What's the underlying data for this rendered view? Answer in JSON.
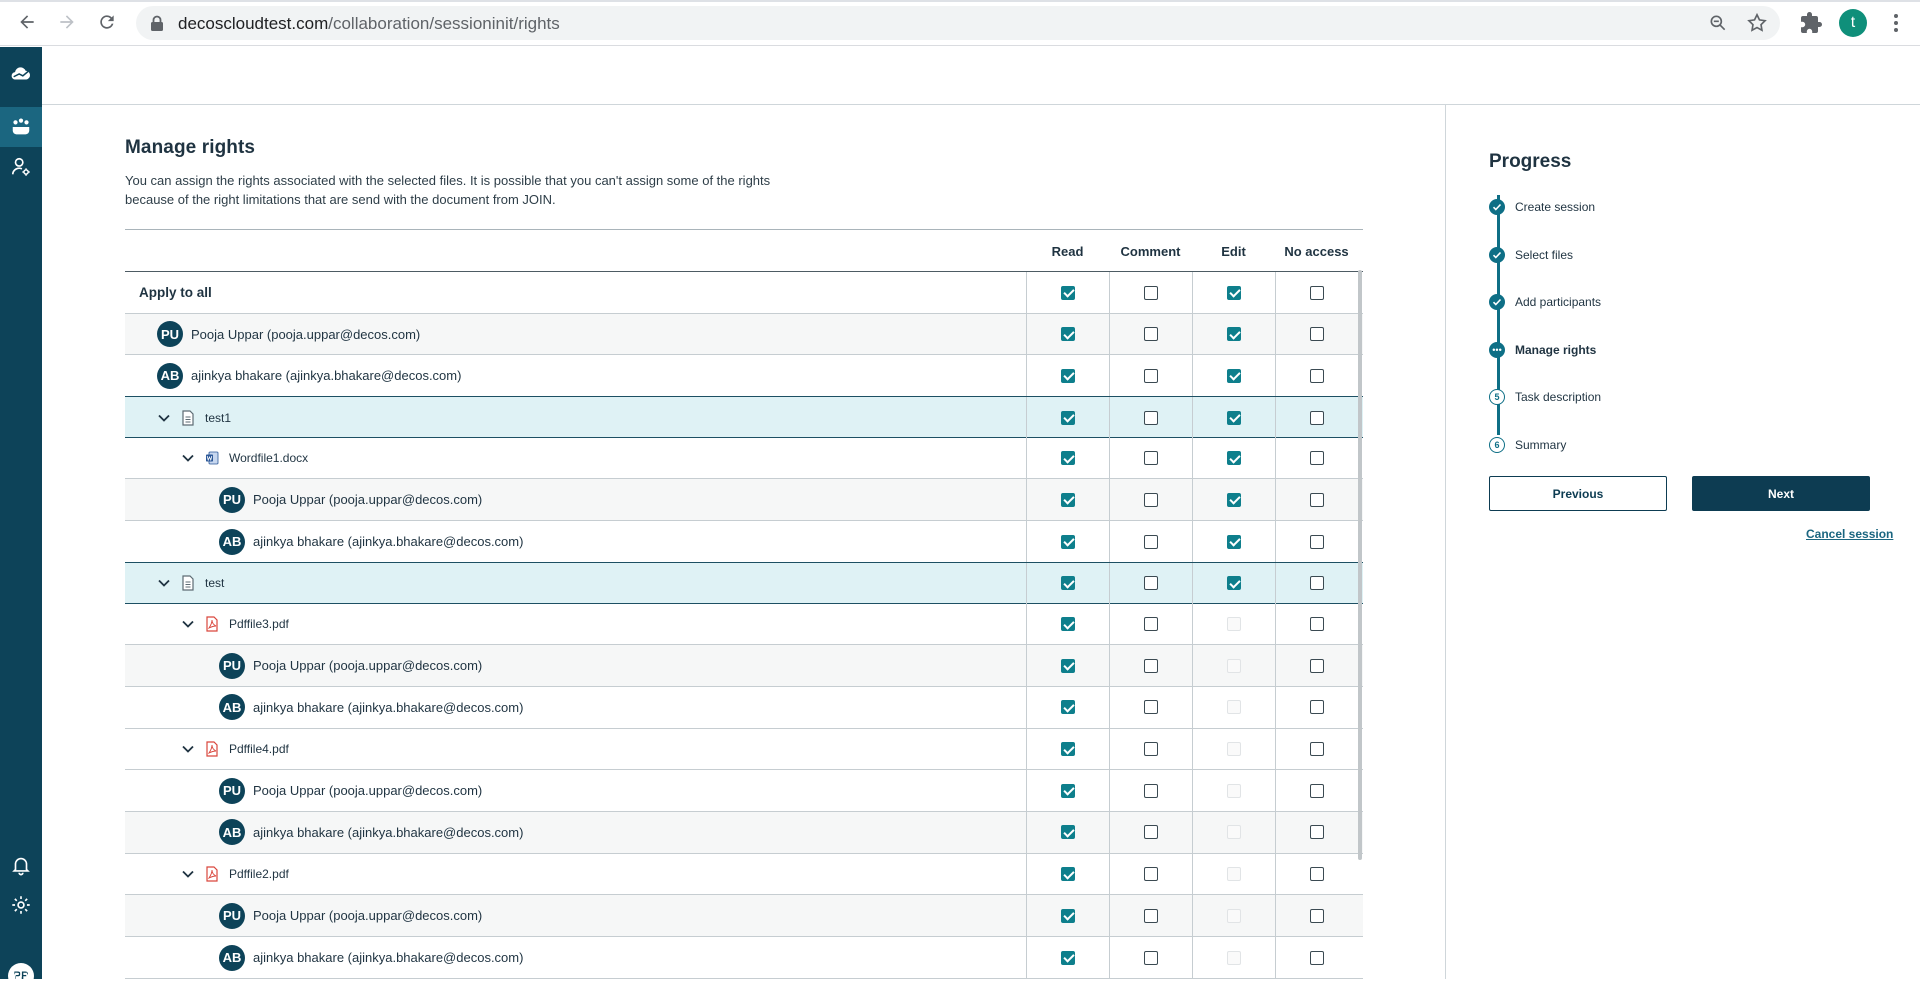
{
  "browser": {
    "url_host": "decoscloudtest.com",
    "url_path": "/collaboration/sessioninit/rights",
    "profile_initial": "t"
  },
  "sidebar": {
    "user_initials": "PP"
  },
  "page": {
    "title": "Manage rights",
    "description": "You can assign the rights associated with the selected files. It is possible that you can't assign some of the rights because of the right limitations that are send with the document from JOIN."
  },
  "table": {
    "columns": [
      "Read",
      "Comment",
      "Edit",
      "No access"
    ],
    "rows": [
      {
        "type": "apply",
        "label": "Apply to all",
        "indent": 0,
        "checks": [
          "on",
          "off",
          "on",
          "off"
        ]
      },
      {
        "type": "user",
        "initials": "PU",
        "label": "Pooja Uppar (pooja.uppar@decos.com)",
        "indent": 1,
        "checks": [
          "on",
          "off",
          "on",
          "off"
        ]
      },
      {
        "type": "user",
        "initials": "AB",
        "label": "ajinkya bhakare (ajinkya.bhakare@decos.com)",
        "indent": 1,
        "checks": [
          "on",
          "off",
          "on",
          "off"
        ]
      },
      {
        "type": "folder",
        "label": "test1",
        "indent": 1,
        "checks": [
          "on",
          "off",
          "on",
          "off"
        ]
      },
      {
        "type": "word",
        "label": "Wordfile1.docx",
        "indent": 2,
        "checks": [
          "on",
          "off",
          "on",
          "off"
        ]
      },
      {
        "type": "user",
        "initials": "PU",
        "label": "Pooja Uppar (pooja.uppar@decos.com)",
        "indent": 3,
        "checks": [
          "on",
          "off",
          "on",
          "off"
        ]
      },
      {
        "type": "user",
        "initials": "AB",
        "label": "ajinkya bhakare (ajinkya.bhakare@decos.com)",
        "indent": 3,
        "checks": [
          "on",
          "off",
          "on",
          "off"
        ]
      },
      {
        "type": "folder",
        "label": "test",
        "indent": 1,
        "checks": [
          "on",
          "off",
          "on",
          "off"
        ]
      },
      {
        "type": "pdf",
        "label": "Pdffile3.pdf",
        "indent": 2,
        "checks": [
          "on",
          "off",
          "dis",
          "off"
        ]
      },
      {
        "type": "user",
        "initials": "PU",
        "label": "Pooja Uppar (pooja.uppar@decos.com)",
        "indent": 3,
        "checks": [
          "on",
          "off",
          "dis",
          "off"
        ]
      },
      {
        "type": "user",
        "initials": "AB",
        "label": "ajinkya bhakare (ajinkya.bhakare@decos.com)",
        "indent": 3,
        "checks": [
          "on",
          "off",
          "dis",
          "off"
        ]
      },
      {
        "type": "pdf",
        "label": "Pdffile4.pdf",
        "indent": 2,
        "checks": [
          "on",
          "off",
          "dis",
          "off"
        ]
      },
      {
        "type": "user",
        "initials": "PU",
        "label": "Pooja Uppar (pooja.uppar@decos.com)",
        "indent": 3,
        "checks": [
          "on",
          "off",
          "dis",
          "off"
        ]
      },
      {
        "type": "user",
        "initials": "AB",
        "label": "ajinkya bhakare (ajinkya.bhakare@decos.com)",
        "indent": 3,
        "checks": [
          "on",
          "off",
          "dis",
          "off"
        ]
      },
      {
        "type": "pdf",
        "label": "Pdffile2.pdf",
        "indent": 2,
        "checks": [
          "on",
          "off",
          "dis",
          "off"
        ]
      },
      {
        "type": "user",
        "initials": "PU",
        "label": "Pooja Uppar (pooja.uppar@decos.com)",
        "indent": 3,
        "checks": [
          "on",
          "off",
          "dis",
          "off"
        ]
      },
      {
        "type": "user",
        "initials": "AB",
        "label": "ajinkya bhakare (ajinkya.bhakare@decos.com)",
        "indent": 3,
        "checks": [
          "on",
          "off",
          "dis",
          "off"
        ]
      }
    ]
  },
  "progress": {
    "title": "Progress",
    "steps": [
      {
        "label": "Create session",
        "state": "done",
        "marker": ""
      },
      {
        "label": "Select files",
        "state": "done",
        "marker": ""
      },
      {
        "label": "Add participants",
        "state": "done",
        "marker": ""
      },
      {
        "label": "Manage rights",
        "state": "current",
        "marker": "•••"
      },
      {
        "label": "Task description",
        "state": "todo",
        "marker": "5"
      },
      {
        "label": "Summary",
        "state": "todo",
        "marker": "6"
      }
    ],
    "previous_label": "Previous",
    "next_label": "Next",
    "cancel_label": "Cancel session"
  }
}
